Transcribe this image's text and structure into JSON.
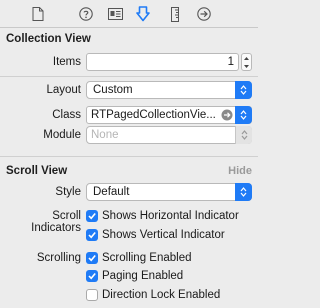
{
  "toolbar": {
    "icons": [
      "file-inspector-icon",
      "quick-help-icon",
      "identity-inspector-icon",
      "attributes-inspector-icon",
      "size-inspector-icon",
      "connections-inspector-icon"
    ],
    "active": "attributes-inspector-icon",
    "accent_color": "#1f7bf6"
  },
  "collection_view": {
    "title": "Collection View",
    "items_label": "Items",
    "items_value": "1",
    "layout_label": "Layout",
    "layout_value": "Custom",
    "class_label": "Class",
    "class_value": "RTPagedCollectionVie...",
    "module_label": "Module",
    "module_placeholder": "None"
  },
  "scroll_view": {
    "title": "Scroll View",
    "hide_label": "Hide",
    "style_label": "Style",
    "style_value": "Default",
    "indicators_label": "Scroll Indicators",
    "show_horizontal_label": "Shows Horizontal Indicator",
    "show_horizontal_checked": true,
    "show_vertical_label": "Shows Vertical Indicator",
    "show_vertical_checked": true,
    "scrolling_label": "Scrolling",
    "scrolling_enabled_label": "Scrolling Enabled",
    "scrolling_enabled_checked": true,
    "paging_enabled_label": "Paging Enabled",
    "paging_enabled_checked": true,
    "direction_lock_label": "Direction Lock Enabled",
    "direction_lock_checked": false
  }
}
